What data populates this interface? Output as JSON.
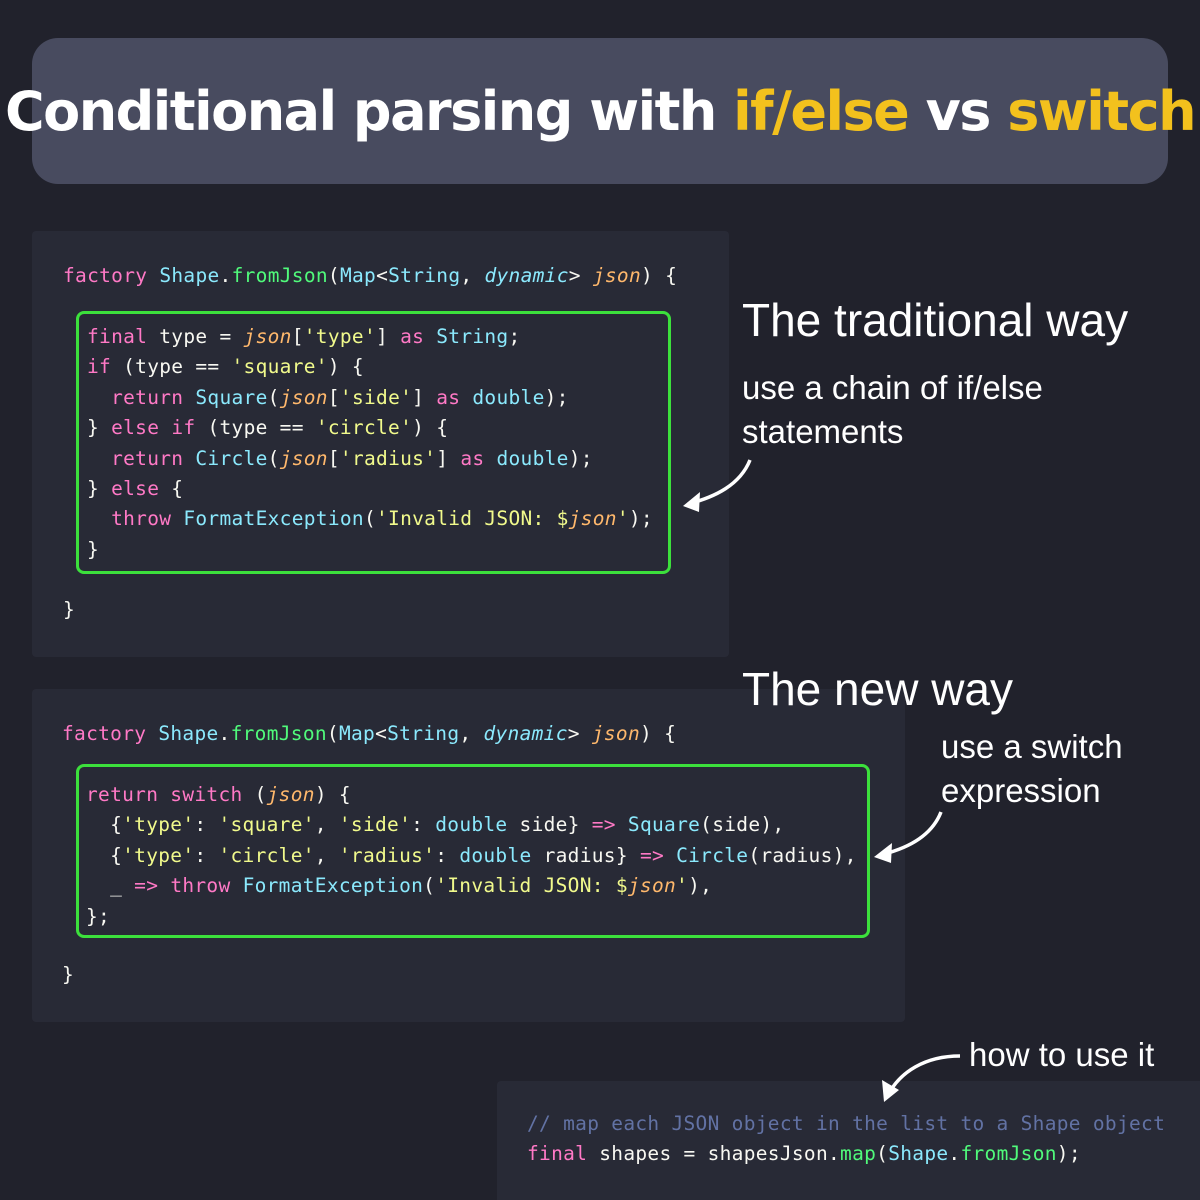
{
  "title": {
    "prefix": "Conditional parsing with ",
    "highlight1": "if/else",
    "middle": " vs ",
    "highlight2": "switch"
  },
  "sections": {
    "traditional": {
      "heading": "The traditional way",
      "description": "use a chain of if/else statements"
    },
    "new": {
      "heading": "The new way",
      "description": "use a switch expression"
    },
    "usage": {
      "heading": "how to use it",
      "comment": "// map each JSON object in the list to a Shape object"
    }
  },
  "colors": {
    "background": "#21222c",
    "banner": "#484b5f",
    "highlight": "#f3c11d",
    "box_border": "#3ce03c"
  },
  "icons": [
    "curved-arrow-icon"
  ]
}
